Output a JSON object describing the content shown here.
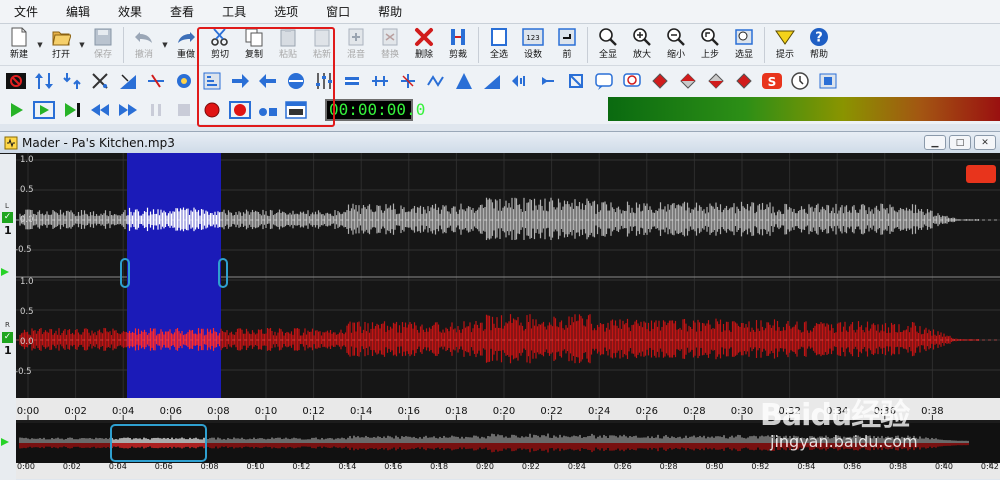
{
  "menu": [
    "文件",
    "编辑",
    "效果",
    "查看",
    "工具",
    "选项",
    "窗口",
    "帮助"
  ],
  "toolbar": {
    "new": "新建",
    "open": "打开",
    "save": "保存",
    "undo": "撤消",
    "redo": "重做",
    "cut": "剪切",
    "copy": "复制",
    "paste": "粘贴",
    "paste_new": "粘新",
    "mix": "混音",
    "replace": "替换",
    "delete": "删除",
    "trim": "剪裁",
    "select_all": "全选",
    "set_number": "设数",
    "prev": "前",
    "show_all": "全显",
    "zoom_in": "放大",
    "zoom_out": "缩小",
    "last_step": "上步",
    "select_show": "选显",
    "hint": "提示",
    "help": "帮助"
  },
  "counter": {
    "value": "00:00:00.0"
  },
  "document": {
    "title": "Mader - Pa's Kitchen.mp3"
  },
  "channels": {
    "left_label": "L",
    "right_label": "R",
    "left_num": "1",
    "right_num": "1"
  },
  "y_labels": [
    "1.0",
    "0.5",
    "0.0",
    "-0.5"
  ],
  "timeline_labels": [
    "0:00",
    "0:02",
    "0:04",
    "0:06",
    "0:08",
    "0:10",
    "0:12",
    "0:14",
    "0:16",
    "0:18",
    "0:20",
    "0:22",
    "0:24",
    "0:26",
    "0:28",
    "0:30",
    "0:32",
    "0:34",
    "0:36",
    "0:38"
  ],
  "overview_labels": [
    "0:00",
    "0:02",
    "0:04",
    "0:06",
    "0:08",
    "0:10",
    "0:12",
    "0:14",
    "0:16",
    "0:18",
    "0:20",
    "0:22",
    "0:24",
    "0:26",
    "0:28",
    "0:30",
    "0:32",
    "0:34",
    "0:36",
    "0:38",
    "0:40",
    "0:42"
  ],
  "watermark": {
    "brand": "Baidu经验",
    "url": "jingyan.baidu.com"
  },
  "colors": {
    "selection": "#1b1bb8",
    "left_wave": "#b0b0b0",
    "right_wave": "#c01414",
    "highlight_box": "#e01a1a"
  }
}
